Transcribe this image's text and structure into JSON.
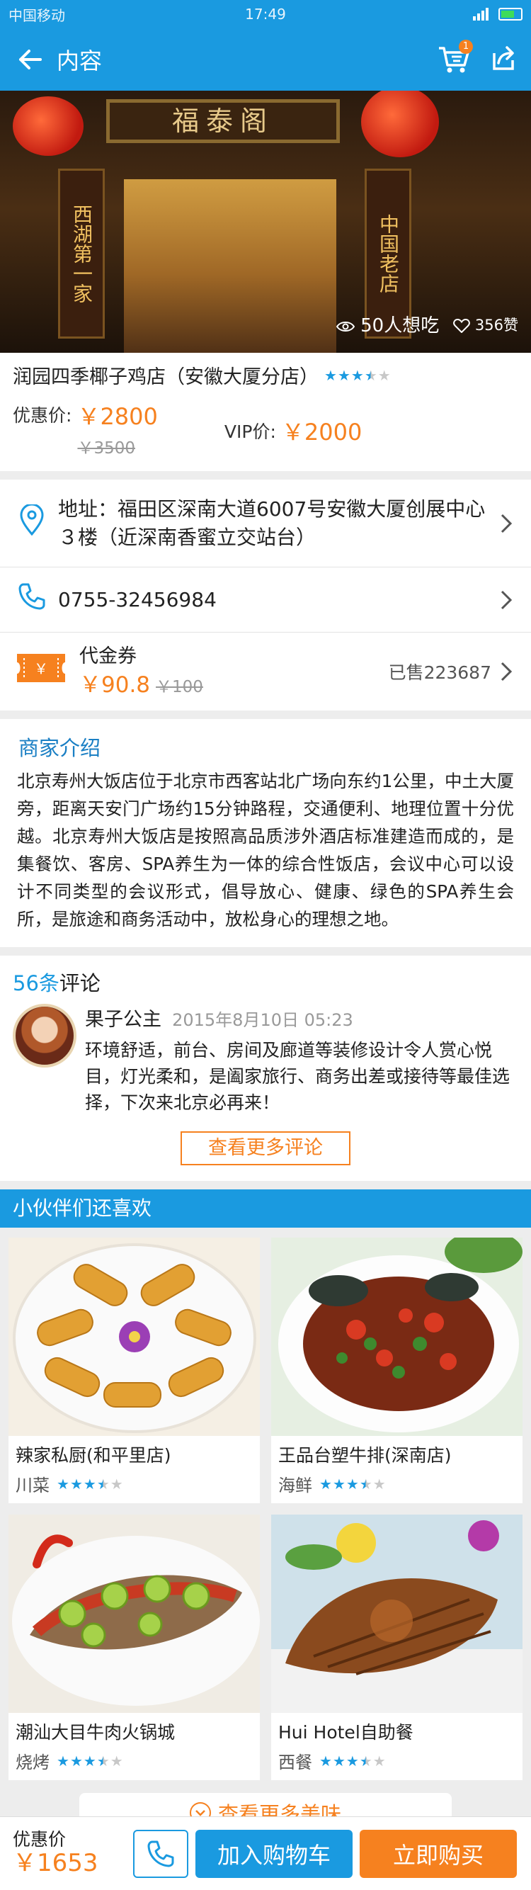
{
  "status_bar": {
    "carrier": "中国移动",
    "time": "17:49"
  },
  "header": {
    "back_icon": "arrow-left-icon",
    "title": "内容",
    "cart_badge": "1",
    "cart_icon": "cart-icon",
    "share_icon": "share-icon"
  },
  "hero": {
    "signboard": "福泰阁",
    "left_couplet": "西湖第一家",
    "right_couplet": "中国老店",
    "want_count": "50人想吃",
    "like_count": "356赞"
  },
  "store": {
    "name": "润园四季椰子鸡店（安徽大厦分店）",
    "rating": 3.5,
    "discount_label": "优惠价:",
    "discount_price": "￥2800",
    "original_price": "￥3500",
    "vip_label": "VIP价:",
    "vip_price": "￥2000"
  },
  "address": {
    "text": "地址：福田区深南大道6007号安徽大厦创展中心３楼（近深南香蜜立交站台）"
  },
  "phone": {
    "text": "0755-32456984"
  },
  "coupon": {
    "title": "代金券",
    "price": "￥90.8",
    "original": "￥100",
    "sold": "已售223687"
  },
  "intro": {
    "title": "商家介绍",
    "text": "北京寿州大饭店位于北京市西客站北广场向东约1公里，中土大厦旁，距离天安门广场约15分钟路程，交通便利、地理位置十分优越。北京寿州大饭店是按照高品质涉外酒店标准建造而成的，是集餐饮、客房、SPA养生为一体的综合性饭店，会议中心可以设计不同类型的会议形式，倡导放心、健康、绿色的SPA养生会所，是旅途和商务活动中，放松身心的理想之地。"
  },
  "comments": {
    "count": "56条",
    "label": "评论",
    "items": [
      {
        "user": "果子公主",
        "date": "2015年8月10日  05:23",
        "text": "环境舒适，前台、房间及廊道等装修设计令人赏心悦目，灯光柔和，是阖家旅行、商务出差或接待等最佳选择，下次来北京必再来！"
      }
    ],
    "more_label": "查看更多评论"
  },
  "recommend": {
    "title": "小伙伴们还喜欢",
    "items": [
      {
        "name": "辣家私厨(和平里店)",
        "category": "川菜",
        "rating": 3.5
      },
      {
        "name": "王品台塑牛排(深南店)",
        "category": "海鲜",
        "rating": 3.5
      },
      {
        "name": "潮汕大目牛肉火锅城",
        "category": "烧烤",
        "rating": 3.5
      },
      {
        "name": "Hui Hotel自助餐",
        "category": "西餐",
        "rating": 3.5
      }
    ],
    "more_label": "查看更多美味"
  },
  "bottom_bar": {
    "price_label": "优惠价",
    "price": "￥1653",
    "cart_label": "加入购物车",
    "buy_label": "立即购买"
  },
  "colors": {
    "primary": "#1a9ae0",
    "accent": "#f6811f"
  }
}
